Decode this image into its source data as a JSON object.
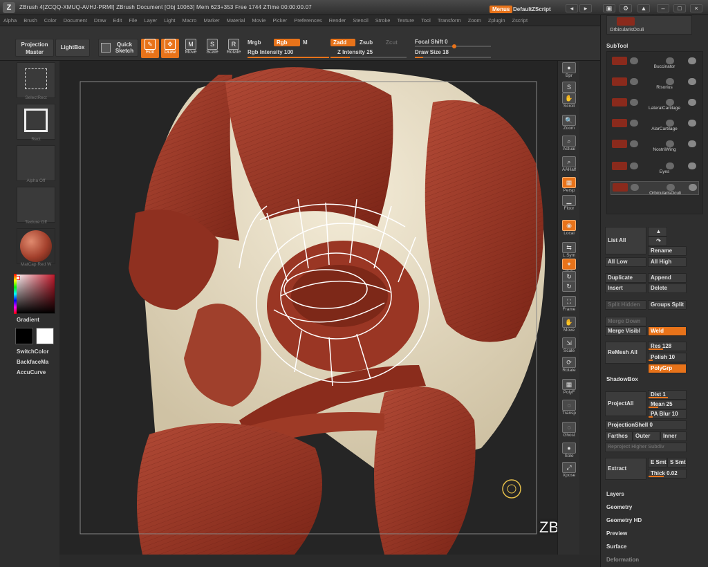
{
  "titlebar": {
    "logo": "Z",
    "title": "ZBrush 4[ZCQQ-XMUQ-AVHJ-PRMI]   ZBrush Document    [Obj 10063] Mem 623+353  Free 1744  ZTime 00:00:00.07",
    "menus_btn": "Menus",
    "script": "DefaultZScript"
  },
  "menubar": [
    "Alpha",
    "Brush",
    "Color",
    "Document",
    "Draw",
    "Edit",
    "File",
    "Layer",
    "Light",
    "Macro",
    "Marker",
    "Material",
    "Movie",
    "Picker",
    "Preferences",
    "Render",
    "Stencil",
    "Stroke",
    "Texture",
    "Tool",
    "Transform",
    "Zoom",
    "Zplugin",
    "Zscript"
  ],
  "shelf": {
    "projection_master": "Projection Master",
    "lightbox": "LightBox",
    "quick_sketch": "Quick Sketch",
    "tools": [
      {
        "label": "Edit",
        "icon": "edit-icon",
        "active": true,
        "glyph": "✎"
      },
      {
        "label": "Draw",
        "icon": "draw-icon",
        "active": true,
        "glyph": "✥"
      },
      {
        "label": "Move",
        "icon": "move-icon",
        "active": false,
        "glyph": "M"
      },
      {
        "label": "Scale",
        "icon": "scale-icon",
        "active": false,
        "glyph": "S"
      },
      {
        "label": "Rotate",
        "icon": "rotate-icon",
        "active": false,
        "glyph": "R"
      }
    ],
    "mrgb": "Mrgb",
    "rgb": "Rgb",
    "m": "M",
    "rgb_intensity": "Rgb Intensity 100",
    "zadd": "Zadd",
    "zsub": "Zsub",
    "zcut": "Zcut",
    "z_intensity": "Z Intensity 25",
    "focal_shift": "Focal Shift 0",
    "draw_size": "Draw Size 18",
    "values": {
      "rgb_intensity": 100,
      "z_intensity": 25,
      "focal_shift": 0,
      "draw_size": 18
    }
  },
  "left_tray": {
    "brush_label": "SelectRect",
    "stroke_label": "Rect",
    "alpha_label": "Alpha Off",
    "texture_label": "Texture Off",
    "material_label": "MatCap Red W",
    "gradient": "Gradient",
    "switch_color": "SwitchColor",
    "backface": "BackfaceMa",
    "accucurve": "AccuCurve",
    "colors": {
      "main": "#000000",
      "secondary": "#ffffff",
      "material": "#a3402c"
    }
  },
  "watermark": "ZBrushWorkshops",
  "right_strip": [
    {
      "label": "Bpr",
      "icon": "bpr-icon",
      "active": false,
      "glyph": "●"
    },
    {
      "label": "SPix",
      "icon": "spix-icon",
      "active": false,
      "glyph": "S"
    },
    {
      "label": "Scroll",
      "icon": "scroll-hand-icon",
      "active": false,
      "glyph": "✋"
    },
    {
      "label": "Zoom",
      "icon": "zoom-icon",
      "active": false,
      "glyph": "🔍"
    },
    {
      "label": "Actual",
      "icon": "actual-icon",
      "active": false,
      "glyph": "⌕"
    },
    {
      "label": "AAHalf",
      "icon": "aahalf-icon",
      "active": false,
      "glyph": "⌕"
    },
    {
      "label": "Persp",
      "icon": "persp-icon",
      "active": true,
      "glyph": "▦"
    },
    {
      "label": "Floor",
      "icon": "floor-icon",
      "active": false,
      "glyph": "▁"
    },
    {
      "label": "Local",
      "icon": "local-icon",
      "active": true,
      "glyph": "◉"
    },
    {
      "label": "L.Sym",
      "icon": "lsym-icon",
      "active": false,
      "glyph": "⇆"
    },
    {
      "label": "Xyz",
      "icon": "xyz-icon",
      "active": true,
      "glyph": "✦"
    },
    {
      "label": "",
      "icon": "rot-y-icon",
      "active": false,
      "glyph": "↻"
    },
    {
      "label": "",
      "icon": "rot-z-icon",
      "active": false,
      "glyph": "↻"
    },
    {
      "label": "Frame",
      "icon": "frame-icon",
      "active": false,
      "glyph": "⛶"
    },
    {
      "label": "Move",
      "icon": "move-hand-icon",
      "active": false,
      "glyph": "✋"
    },
    {
      "label": "Scale",
      "icon": "scale-view-icon",
      "active": false,
      "glyph": "⇲"
    },
    {
      "label": "Rotate",
      "icon": "rotate-view-icon",
      "active": false,
      "glyph": "⟳"
    },
    {
      "label": "PolyF",
      "icon": "polyf-icon",
      "active": false,
      "glyph": "▦"
    },
    {
      "label": "Transp",
      "icon": "transp-icon",
      "active": false,
      "glyph": "◌"
    },
    {
      "label": "Ghost",
      "icon": "ghost-icon",
      "active": false,
      "glyph": "◌"
    },
    {
      "label": "Solo",
      "icon": "solo-icon",
      "active": false,
      "glyph": "●"
    },
    {
      "label": "Xpose",
      "icon": "xpose-icon",
      "active": false,
      "glyph": "⤢"
    }
  ],
  "palette": {
    "top_item": "OrbicularisOculi",
    "subtool_title": "SubTool",
    "subtools": [
      "Buccinator",
      "Risorius",
      "LateralCartilage",
      "AlarCartilage",
      "NostrilWing",
      "Eyes",
      "OrbicularisOculi"
    ],
    "list_all": "List All",
    "rename": "Rename",
    "all_low": "All Low",
    "all_high": "All High",
    "duplicate": "Duplicate",
    "append": "Append",
    "insert": "Insert",
    "delete": "Delete",
    "split_hidden": "Split Hidden",
    "groups_split": "Groups Split",
    "merge_down": "Merge Down",
    "merge_visible": "Merge Visibl",
    "weld": "Weld",
    "remesh_all": "ReMesh All",
    "res": "Res 128",
    "polish": "Polish 10",
    "polygrp": "PolyGrp",
    "shadowbox": "ShadowBox",
    "projectall": "ProjectAll",
    "dist": "Dist 1",
    "mean": "Mean 25",
    "pa_blur": "PA Blur 10",
    "projection_shell": "ProjectionShell 0",
    "farthest": "Farthes",
    "outer": "Outer",
    "inner": "Inner",
    "reproject": "Reproject Higher Subdiv",
    "extract": "Extract",
    "e_smt": "E Smt",
    "s_smt": "S Smt",
    "thick": "Thick 0.02",
    "sections": [
      "Layers",
      "Geometry",
      "Geometry HD",
      "Preview",
      "Surface",
      "Deformation"
    ],
    "values": {
      "res": 128,
      "polish": 10,
      "dist": 1,
      "mean": 25,
      "pa_blur": 10,
      "projection_shell": 0,
      "thick": 0.02
    }
  }
}
